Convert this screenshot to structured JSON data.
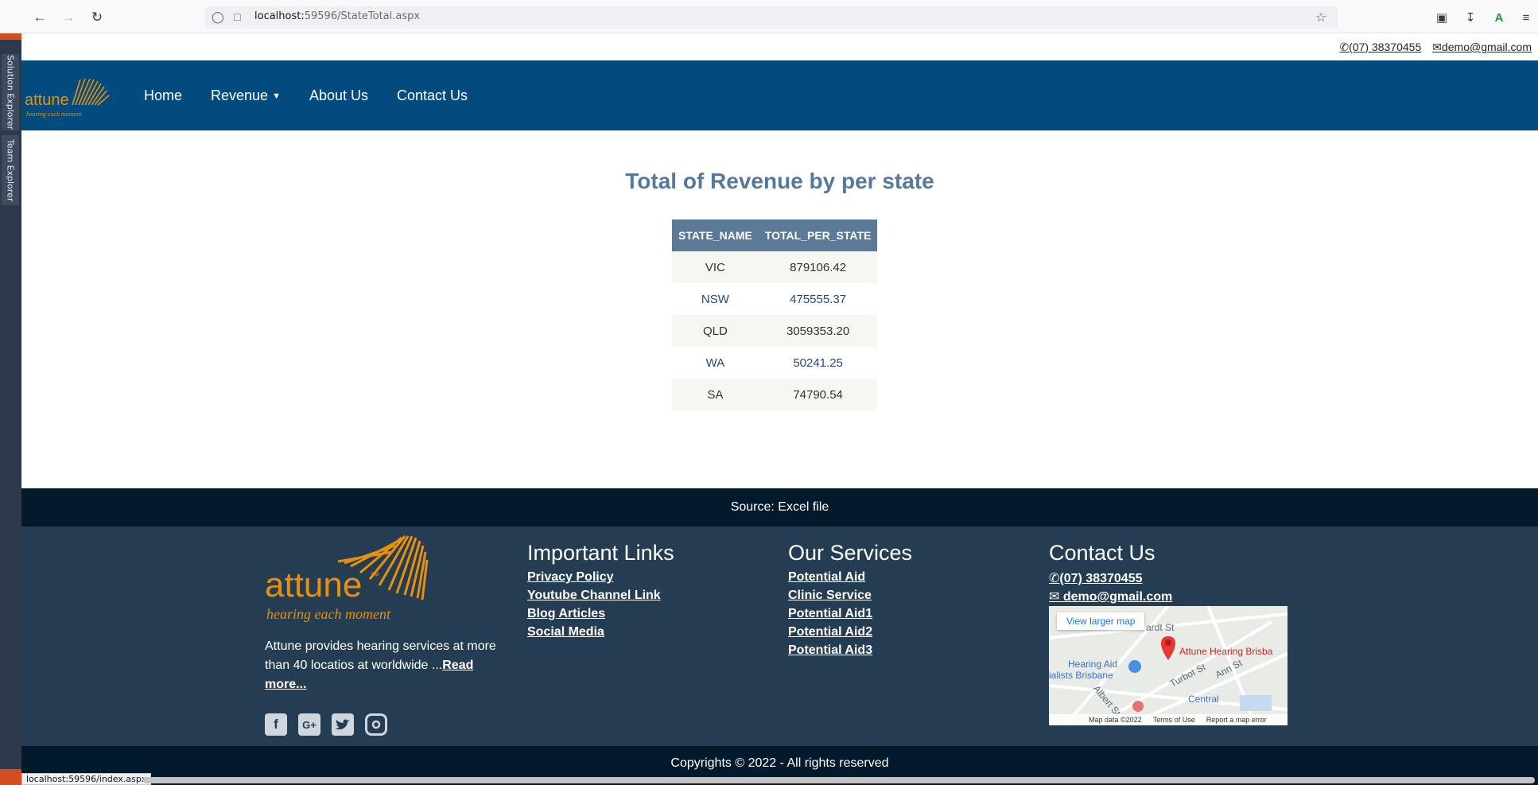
{
  "browser": {
    "url_host": "localhost:",
    "url_path": "59596/StateTotal.aspx",
    "status_url": "localhost:59596/index.aspx"
  },
  "ide": {
    "tabs": [
      "Solution Explorer",
      "Team Explorer"
    ]
  },
  "topbar": {
    "phone": "(07) 38370455",
    "email": "demo@gmail.com"
  },
  "brand": {
    "name": "attune",
    "tm": "™",
    "tagline": "hearing each moment"
  },
  "nav": {
    "items": [
      {
        "label": "Home",
        "dropdown": false
      },
      {
        "label": "Revenue",
        "dropdown": true
      },
      {
        "label": "About Us",
        "dropdown": false
      },
      {
        "label": "Contact Us",
        "dropdown": false
      }
    ]
  },
  "main": {
    "heading": "Total of Revenue by per state",
    "columns": [
      "STATE_NAME",
      "TOTAL_PER_STATE"
    ],
    "rows": [
      {
        "state": "VIC",
        "total": "879106.42"
      },
      {
        "state": "NSW",
        "total": "475555.37"
      },
      {
        "state": "QLD",
        "total": "3059353.20"
      },
      {
        "state": "WA",
        "total": "50241.25"
      },
      {
        "state": "SA",
        "total": "74790.54"
      }
    ]
  },
  "source": "Source: Excel file",
  "footer": {
    "about": {
      "text": "Attune provides hearing services at more than 40 locatios at worldwide ...",
      "read_more": "Read more..."
    },
    "socials": [
      "facebook-icon",
      "google-plus-icon",
      "twitter-icon",
      "instagram-icon"
    ],
    "links": {
      "heading": "Important Links",
      "items": [
        "Privacy Policy",
        "Youtube Channel Link",
        "Blog Articles",
        "Social Media"
      ]
    },
    "services": {
      "heading": "Our Services",
      "items": [
        "Potential Aid",
        "Clinic Service",
        "Potential Aid1",
        "Potential Aid2",
        "Potential Aid3"
      ]
    },
    "contact": {
      "heading": "Contact Us",
      "phone": "(07) 38370455",
      "email": "demo@gmail.com"
    },
    "map": {
      "view_larger": "View larger map",
      "place": "Attune Hearing Brisba",
      "labels": [
        "Hearing Aid",
        "ialists Brisbane",
        "Turbot St",
        "Ann St",
        "Central",
        "ardt St",
        "Albert St"
      ],
      "footer": [
        "Map data ©2022",
        "Terms of Use",
        "Report a map error"
      ]
    }
  },
  "copyright": "Copyrights © 2022 - All rights reserved",
  "colors": {
    "navbar": "#024b7e",
    "footer": "#243d52",
    "dark_bar": "#031a2c",
    "brand_orange": "#e8900c",
    "heading": "#56789b"
  }
}
